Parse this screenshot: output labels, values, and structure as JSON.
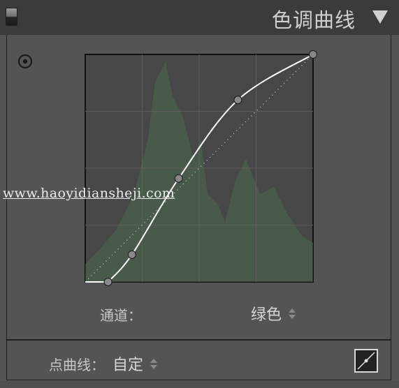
{
  "panel": {
    "title": "色调曲线"
  },
  "icons": {
    "panel_toggle": "panel-toggle-icon",
    "collapse": "triangle-down-icon",
    "target_adjust": "target-adjust-icon",
    "curve_edit": "point-curve-edit-icon"
  },
  "channel": {
    "label": "通道：",
    "value": "绿色"
  },
  "point_curve": {
    "label": "点曲线：",
    "value": "自定"
  },
  "watermark": "www.haoyidiansheji.com",
  "curve": {
    "input_range": [
      0,
      1
    ],
    "output_range": [
      0,
      1
    ],
    "points": [
      {
        "in": 0.1,
        "out": 0.0
      },
      {
        "in": 0.205,
        "out": 0.12
      },
      {
        "in": 0.41,
        "out": 0.455
      },
      {
        "in": 0.67,
        "out": 0.8
      },
      {
        "in": 1.0,
        "out": 1.0
      }
    ],
    "flat_segment_end": 0.1
  },
  "colors": {
    "header_bg": "#3b3b3b",
    "panel_bg": "#545454",
    "graph_bg": "#474747",
    "histogram": "#4a6a4c",
    "curve": "#ffffff",
    "grid": "#5e5e5e"
  }
}
